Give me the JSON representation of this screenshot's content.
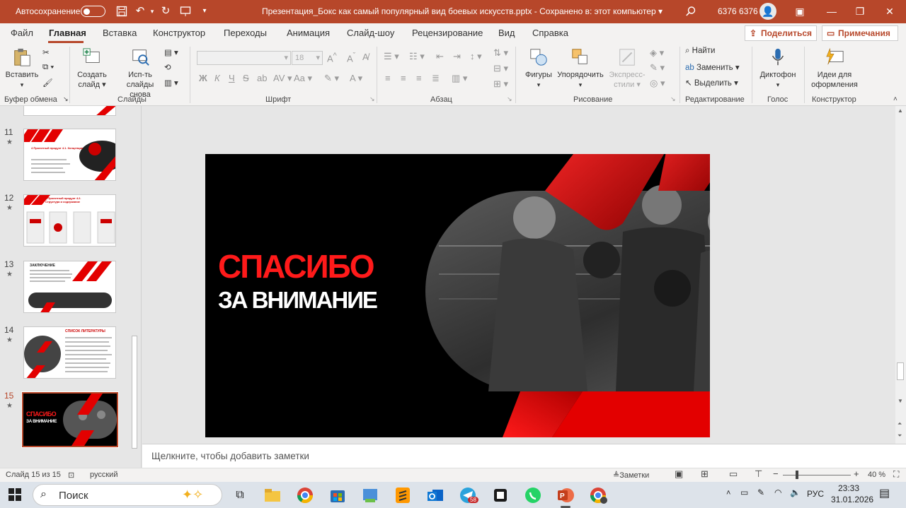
{
  "titlebar": {
    "autosave_label": "Автосохранение",
    "document_title": "Презентация_Бокс как самый популярный вид боевых искусств.pptx  -  Сохранено в: этот компьютер ▾",
    "user_name": "6376 6376"
  },
  "menu": {
    "tabs": [
      "Файл",
      "Главная",
      "Вставка",
      "Конструктор",
      "Переходы",
      "Анимация",
      "Слайд-шоу",
      "Рецензирование",
      "Вид",
      "Справка"
    ],
    "share_label": "Поделиться",
    "comments_label": "Примечания"
  },
  "ribbon": {
    "clipboard": {
      "paste": "Вставить",
      "group": "Буфер обмена"
    },
    "slides": {
      "new_slide": "Создать слайд",
      "reuse": "Исп-ть слайды снова",
      "group": "Слайды"
    },
    "font": {
      "size": "18",
      "group": "Шрифт",
      "bold": "Ж",
      "italic": "К",
      "underline": "Ч",
      "strike": "S",
      "grow": "A",
      "clear": "A"
    },
    "paragraph": {
      "group": "Абзац"
    },
    "drawing": {
      "shapes": "Фигуры",
      "arrange": "Упорядочить",
      "quick_styles": "Экспресс-стили",
      "group": "Рисование"
    },
    "editing": {
      "find": "Найти",
      "replace": "Заменить",
      "select": "Выделить",
      "group": "Редактирование"
    },
    "voice": {
      "dictate": "Диктофон",
      "group": "Голос"
    },
    "designer": {
      "ideas": "Идеи для оформления",
      "group": "Конструктор"
    }
  },
  "thumbnails": [
    {
      "num": "11",
      "title": "4 Проектный продукт 4.1. Концепция"
    },
    {
      "num": "12",
      "title": "4 Проектный продукт 4.2. Структура и содержание"
    },
    {
      "num": "13",
      "title": "ЗАКЛЮЧЕНИЕ"
    },
    {
      "num": "14",
      "title": "СПИСОК ЛИТЕРАТУРЫ"
    },
    {
      "num": "15",
      "title1": "СПАСИБО",
      "title2": "ЗА ВНИМАНИЕ"
    }
  ],
  "slide": {
    "title_line1": "СПАСИБО",
    "title_line2": "ЗА ВНИМАНИЕ"
  },
  "notes_placeholder": "Щелкните, чтобы добавить заметки",
  "status": {
    "slide_count": "Слайд 15 из 15",
    "language": "русский",
    "notes_label": "Заметки",
    "zoom": "40 %"
  },
  "taskbar": {
    "search_placeholder": "Поиск",
    "telegram_badge": "58",
    "lang": "РУС",
    "time": "23:33",
    "date": "31.01.2026"
  },
  "colors": {
    "accent": "#b7472a",
    "slide_red": "#ff1a1a"
  }
}
